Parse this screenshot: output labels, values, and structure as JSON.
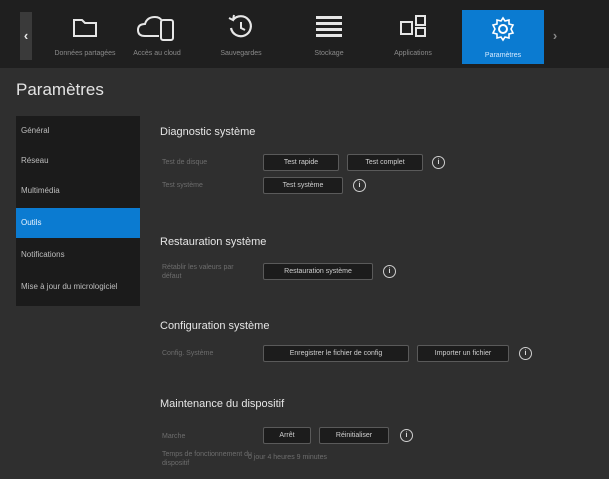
{
  "nav": {
    "items": [
      {
        "label": "Données partagées",
        "icon": "folder-icon"
      },
      {
        "label": "Accès au cloud",
        "icon": "cloud-device-icon"
      },
      {
        "label": "Sauvegardes",
        "icon": "history-icon"
      },
      {
        "label": "Stockage",
        "icon": "storage-icon"
      },
      {
        "label": "Applications",
        "icon": "apps-icon"
      },
      {
        "label": "Paramètres",
        "icon": "gear-icon"
      }
    ],
    "active": "Paramètres",
    "prev_glyph": "‹",
    "next_glyph": "›"
  },
  "page_title": "Paramètres",
  "sidebar": {
    "items": [
      "Général",
      "Réseau",
      "Multimédia",
      "Outils",
      "Notifications",
      "Mise à jour du micrologiciel"
    ],
    "active": "Outils"
  },
  "sections": {
    "diagnostic": {
      "title": "Diagnostic système",
      "disk_label": "Test de disque",
      "quick_btn": "Test rapide",
      "full_btn": "Test complet",
      "system_label": "Test système",
      "system_btn": "Test système"
    },
    "restore": {
      "title": "Restauration système",
      "label": "Rétablir les valeurs par défaut",
      "btn": "Restauration système"
    },
    "config": {
      "title": "Configuration système",
      "label": "Config. Système",
      "save_btn": "Enregistrer le fichier de config",
      "import_btn": "Importer un fichier"
    },
    "maintenance": {
      "title": "Maintenance du dispositif",
      "label": "Marche",
      "stop_btn": "Arrêt",
      "restart_btn": "Réinitialiser",
      "uptime_label": "Temps de fonctionnement du dispositif",
      "uptime_value": "0 jour 4 heures 9 minutes"
    }
  },
  "info_glyph": "i",
  "colors": {
    "accent": "#0b7bd1",
    "background": "#2f2f2f",
    "topbar": "#1f1f1f",
    "sidebar": "#1b1b1b"
  }
}
